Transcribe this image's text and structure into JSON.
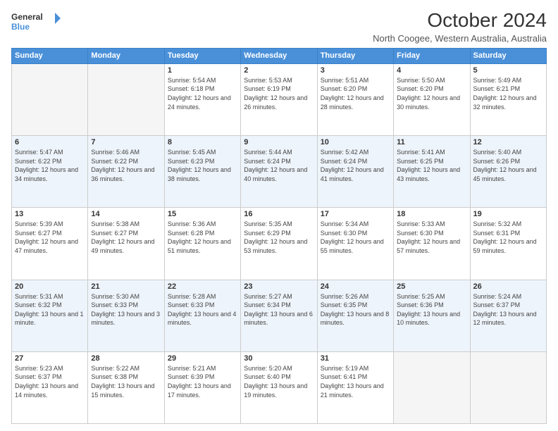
{
  "header": {
    "logo": {
      "line1": "General",
      "line2": "Blue"
    },
    "title": "October 2024",
    "subtitle": "North Coogee, Western Australia, Australia"
  },
  "weekdays": [
    "Sunday",
    "Monday",
    "Tuesday",
    "Wednesday",
    "Thursday",
    "Friday",
    "Saturday"
  ],
  "weeks": [
    [
      {
        "day": "",
        "empty": true
      },
      {
        "day": "",
        "empty": true
      },
      {
        "day": "1",
        "sunrise": "5:54 AM",
        "sunset": "6:18 PM",
        "daylight": "12 hours and 24 minutes."
      },
      {
        "day": "2",
        "sunrise": "5:53 AM",
        "sunset": "6:19 PM",
        "daylight": "12 hours and 26 minutes."
      },
      {
        "day": "3",
        "sunrise": "5:51 AM",
        "sunset": "6:20 PM",
        "daylight": "12 hours and 28 minutes."
      },
      {
        "day": "4",
        "sunrise": "5:50 AM",
        "sunset": "6:20 PM",
        "daylight": "12 hours and 30 minutes."
      },
      {
        "day": "5",
        "sunrise": "5:49 AM",
        "sunset": "6:21 PM",
        "daylight": "12 hours and 32 minutes."
      }
    ],
    [
      {
        "day": "6",
        "sunrise": "5:47 AM",
        "sunset": "6:22 PM",
        "daylight": "12 hours and 34 minutes."
      },
      {
        "day": "7",
        "sunrise": "5:46 AM",
        "sunset": "6:22 PM",
        "daylight": "12 hours and 36 minutes."
      },
      {
        "day": "8",
        "sunrise": "5:45 AM",
        "sunset": "6:23 PM",
        "daylight": "12 hours and 38 minutes."
      },
      {
        "day": "9",
        "sunrise": "5:44 AM",
        "sunset": "6:24 PM",
        "daylight": "12 hours and 40 minutes."
      },
      {
        "day": "10",
        "sunrise": "5:42 AM",
        "sunset": "6:24 PM",
        "daylight": "12 hours and 41 minutes."
      },
      {
        "day": "11",
        "sunrise": "5:41 AM",
        "sunset": "6:25 PM",
        "daylight": "12 hours and 43 minutes."
      },
      {
        "day": "12",
        "sunrise": "5:40 AM",
        "sunset": "6:26 PM",
        "daylight": "12 hours and 45 minutes."
      }
    ],
    [
      {
        "day": "13",
        "sunrise": "5:39 AM",
        "sunset": "6:27 PM",
        "daylight": "12 hours and 47 minutes."
      },
      {
        "day": "14",
        "sunrise": "5:38 AM",
        "sunset": "6:27 PM",
        "daylight": "12 hours and 49 minutes."
      },
      {
        "day": "15",
        "sunrise": "5:36 AM",
        "sunset": "6:28 PM",
        "daylight": "12 hours and 51 minutes."
      },
      {
        "day": "16",
        "sunrise": "5:35 AM",
        "sunset": "6:29 PM",
        "daylight": "12 hours and 53 minutes."
      },
      {
        "day": "17",
        "sunrise": "5:34 AM",
        "sunset": "6:30 PM",
        "daylight": "12 hours and 55 minutes."
      },
      {
        "day": "18",
        "sunrise": "5:33 AM",
        "sunset": "6:30 PM",
        "daylight": "12 hours and 57 minutes."
      },
      {
        "day": "19",
        "sunrise": "5:32 AM",
        "sunset": "6:31 PM",
        "daylight": "12 hours and 59 minutes."
      }
    ],
    [
      {
        "day": "20",
        "sunrise": "5:31 AM",
        "sunset": "6:32 PM",
        "daylight": "13 hours and 1 minute."
      },
      {
        "day": "21",
        "sunrise": "5:30 AM",
        "sunset": "6:33 PM",
        "daylight": "13 hours and 3 minutes."
      },
      {
        "day": "22",
        "sunrise": "5:28 AM",
        "sunset": "6:33 PM",
        "daylight": "13 hours and 4 minutes."
      },
      {
        "day": "23",
        "sunrise": "5:27 AM",
        "sunset": "6:34 PM",
        "daylight": "13 hours and 6 minutes."
      },
      {
        "day": "24",
        "sunrise": "5:26 AM",
        "sunset": "6:35 PM",
        "daylight": "13 hours and 8 minutes."
      },
      {
        "day": "25",
        "sunrise": "5:25 AM",
        "sunset": "6:36 PM",
        "daylight": "13 hours and 10 minutes."
      },
      {
        "day": "26",
        "sunrise": "5:24 AM",
        "sunset": "6:37 PM",
        "daylight": "13 hours and 12 minutes."
      }
    ],
    [
      {
        "day": "27",
        "sunrise": "5:23 AM",
        "sunset": "6:37 PM",
        "daylight": "13 hours and 14 minutes."
      },
      {
        "day": "28",
        "sunrise": "5:22 AM",
        "sunset": "6:38 PM",
        "daylight": "13 hours and 15 minutes."
      },
      {
        "day": "29",
        "sunrise": "5:21 AM",
        "sunset": "6:39 PM",
        "daylight": "13 hours and 17 minutes."
      },
      {
        "day": "30",
        "sunrise": "5:20 AM",
        "sunset": "6:40 PM",
        "daylight": "13 hours and 19 minutes."
      },
      {
        "day": "31",
        "sunrise": "5:19 AM",
        "sunset": "6:41 PM",
        "daylight": "13 hours and 21 minutes."
      },
      {
        "day": "",
        "empty": true
      },
      {
        "day": "",
        "empty": true
      }
    ]
  ]
}
